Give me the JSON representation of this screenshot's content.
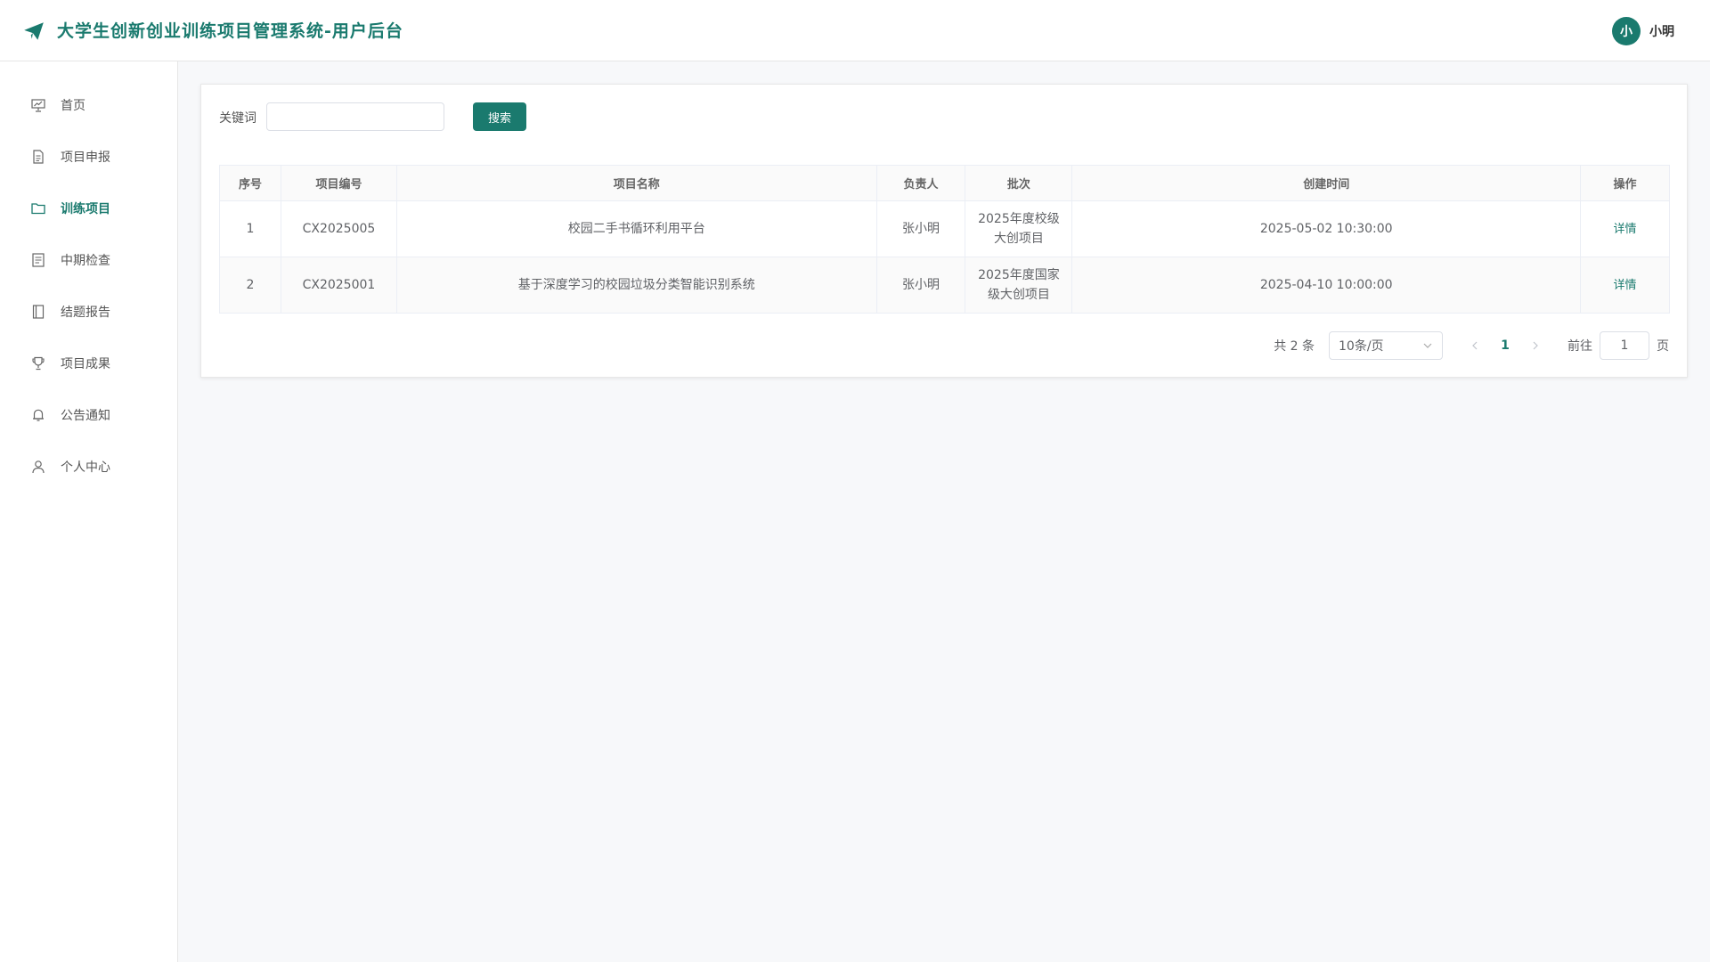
{
  "header": {
    "app_title": "大学生创新创业训练项目管理系统-用户后台",
    "avatar_text": "小",
    "username": "小明"
  },
  "sidebar": {
    "items": [
      {
        "label": "首页",
        "icon": "presentation-chart-icon"
      },
      {
        "label": "项目申报",
        "icon": "document-icon"
      },
      {
        "label": "训练项目",
        "icon": "folder-icon",
        "active": true
      },
      {
        "label": "中期检查",
        "icon": "checklist-icon"
      },
      {
        "label": "结题报告",
        "icon": "notebook-icon"
      },
      {
        "label": "项目成果",
        "icon": "trophy-icon"
      },
      {
        "label": "公告通知",
        "icon": "bell-icon"
      },
      {
        "label": "个人中心",
        "icon": "user-icon"
      }
    ]
  },
  "search": {
    "label": "关键词",
    "value": "",
    "button_label": "搜索"
  },
  "table": {
    "headers": [
      "序号",
      "项目编号",
      "项目名称",
      "负责人",
      "批次",
      "创建时间",
      "操作"
    ],
    "rows": [
      {
        "index": "1",
        "code": "CX2025005",
        "name": "校园二手书循环利用平台",
        "leader": "张小明",
        "batch": "2025年度校级大创项目",
        "created": "2025-05-02 10:30:00",
        "action": "详情"
      },
      {
        "index": "2",
        "code": "CX2025001",
        "name": "基于深度学习的校园垃圾分类智能识别系统",
        "leader": "张小明",
        "batch": "2025年度国家级大创项目",
        "created": "2025-04-10 10:00:00",
        "action": "详情"
      }
    ]
  },
  "pagination": {
    "total_text": "共 2 条",
    "page_size": "10条/页",
    "current_page": "1",
    "goto_label": "前往",
    "goto_value": "1",
    "goto_suffix": "页"
  },
  "colors": {
    "accent": "#1a7a6e"
  }
}
